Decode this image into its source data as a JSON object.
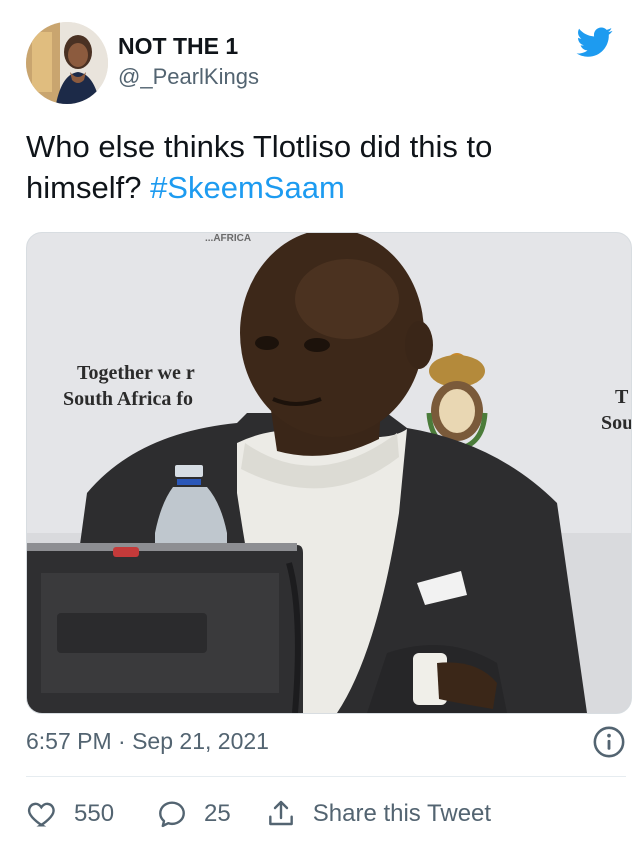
{
  "tweet": {
    "author": {
      "display_name": "NOT THE 1",
      "handle": "@_PearlKings"
    },
    "text_main": "Who else thinks Tlotliso did this to himself?",
    "hashtag": "#SkeemSaam",
    "timestamp": "6:57 PM · Sep 21, 2021",
    "media": {
      "banner_left_line1": "Together we r",
      "banner_left_line2": "South Africa fo",
      "banner_right_line1": "T",
      "banner_right_line2": "Sou",
      "banner_top": "...AFRICA"
    }
  },
  "actions": {
    "like_count": "550",
    "reply_count": "25",
    "share_label": "Share this Tweet"
  },
  "colors": {
    "accent": "#1d9bf0",
    "text_primary": "#0f1419",
    "text_secondary": "#536471",
    "divider": "#e6ecf0"
  },
  "icons": [
    "twitter-bird-icon",
    "info-icon",
    "heart-icon",
    "reply-bubble-icon",
    "share-icon"
  ]
}
